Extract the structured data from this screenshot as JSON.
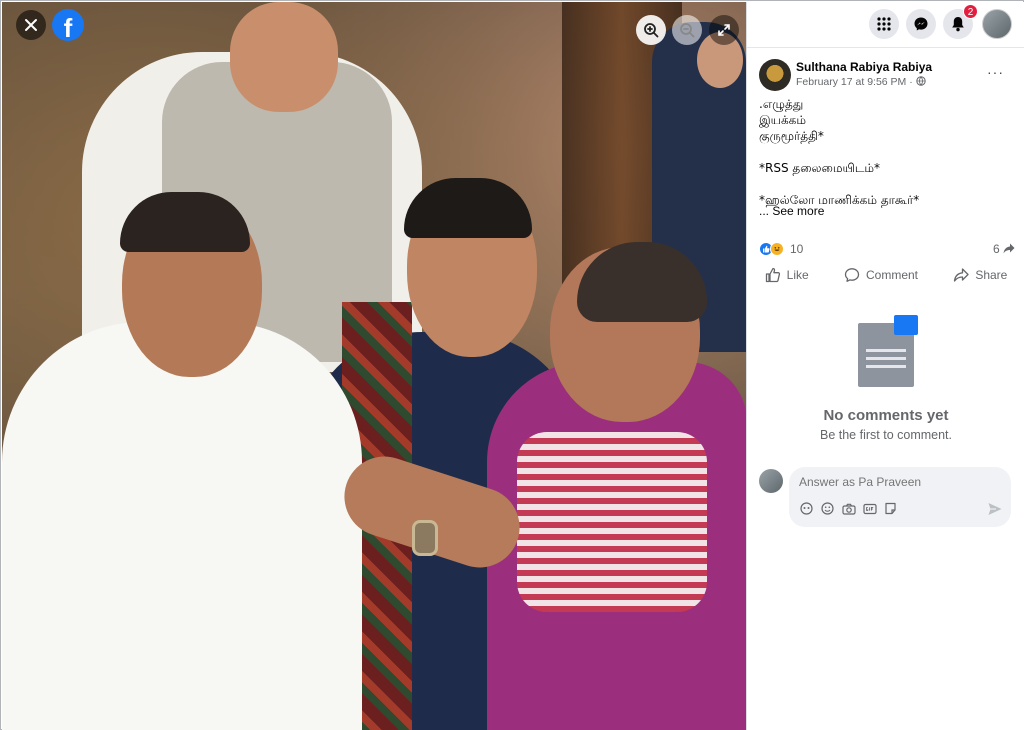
{
  "viewer": {
    "icons": [
      "close-icon",
      "facebook-logo",
      "zoom-in-icon",
      "zoom-out-icon",
      "fullscreen-icon"
    ],
    "logo_letter": "f"
  },
  "topbar": {
    "icons": [
      "menu-grid-icon",
      "messenger-icon",
      "notifications-icon"
    ],
    "notification_count": "2"
  },
  "post": {
    "author": "Sulthana Rabiya Rabiya",
    "date": "February 17 at 9:56 PM",
    "date_suffix": " · ",
    "more_label": "···",
    "text_lines": [
      ".எழுத்து",
      "இயக்கம்",
      "குருமூர்த்தி*",
      "",
      "*RSS தலைமையிடம்*",
      "",
      "*ஹல்லோ மாணிக்கம் தாகூர்*"
    ],
    "see_more": "... See more",
    "reaction_count": "10",
    "share_count": "6",
    "actions": {
      "like": "Like",
      "comment": "Comment",
      "share": "Share"
    }
  },
  "comments": {
    "empty_title": "No comments yet",
    "empty_subtitle": "Be the first to comment.",
    "reply_placeholder": "Answer as Pa Praveen"
  },
  "colors": {
    "brand": "#1877f2",
    "badge": "#e41e3f",
    "secondary_text": "#65676b"
  }
}
